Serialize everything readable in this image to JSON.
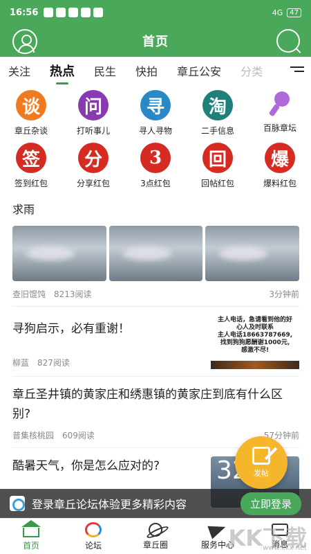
{
  "status": {
    "time": "16:56",
    "battery": "47",
    "network": "4G"
  },
  "header": {
    "title": "首页"
  },
  "tabs": [
    {
      "label": "关注"
    },
    {
      "label": "热点"
    },
    {
      "label": "民生"
    },
    {
      "label": "快拍"
    },
    {
      "label": "章丘公安"
    },
    {
      "label": "分类"
    }
  ],
  "grid": {
    "row1": [
      {
        "glyph": "谈",
        "label": "章丘杂谈",
        "color": "#ef7a20"
      },
      {
        "glyph": "问",
        "label": "打听事儿",
        "color": "#8a3ab0"
      },
      {
        "glyph": "寻",
        "label": "寻人寻物",
        "color": "#2b88c6"
      },
      {
        "glyph": "淘",
        "label": "二手信息",
        "color": "#1f7f7a"
      },
      {
        "glyph": "",
        "label": "百脉章坛",
        "color": "#b06ad8"
      }
    ],
    "row2": [
      {
        "glyph": "签",
        "label": "签到红包",
        "color": "#d52b22"
      },
      {
        "glyph": "分",
        "label": "分享红包",
        "color": "#d52b22"
      },
      {
        "glyph": "3",
        "label": "3点红包",
        "color": "#d52b22"
      },
      {
        "glyph": "回",
        "label": "回帖红包",
        "color": "#d52b22"
      },
      {
        "glyph": "爆",
        "label": "爆料红包",
        "color": "#d52b22"
      }
    ]
  },
  "feed": {
    "post1": {
      "title": "求雨",
      "author": "查旧馄饨",
      "reads": "8213阅读",
      "time": "3分钟前"
    },
    "post2": {
      "title": "寻狗启示，必有重谢！",
      "author": "柳蓝",
      "reads": "827阅读",
      "thumb_text": [
        "主人电话，急请看到他的好",
        "心人及时联系",
        "主人电话18663787669,",
        "找到狗狗愿酬谢1000元,",
        "感激不尽!"
      ]
    },
    "post3": {
      "title": "章丘圣井镇的黄家庄和绣惠镇的黄家庄到底有什么区别?",
      "author": "普集核桃园",
      "reads": "609阅读",
      "time": "57分钟前"
    },
    "post4": {
      "title": "酷暑天气，你是怎么应对的?",
      "weather": "32"
    }
  },
  "fab": {
    "label": "发帖"
  },
  "login_bar": {
    "text": "登录章丘论坛体验更多精彩内容",
    "button": "立即登录"
  },
  "bottom_nav": [
    {
      "label": "首页"
    },
    {
      "label": "论坛"
    },
    {
      "label": "章丘圈"
    },
    {
      "label": "服务中心"
    },
    {
      "label": "消息"
    }
  ],
  "watermark": {
    "text": "KK下载",
    "url": "www.kkx.net"
  }
}
